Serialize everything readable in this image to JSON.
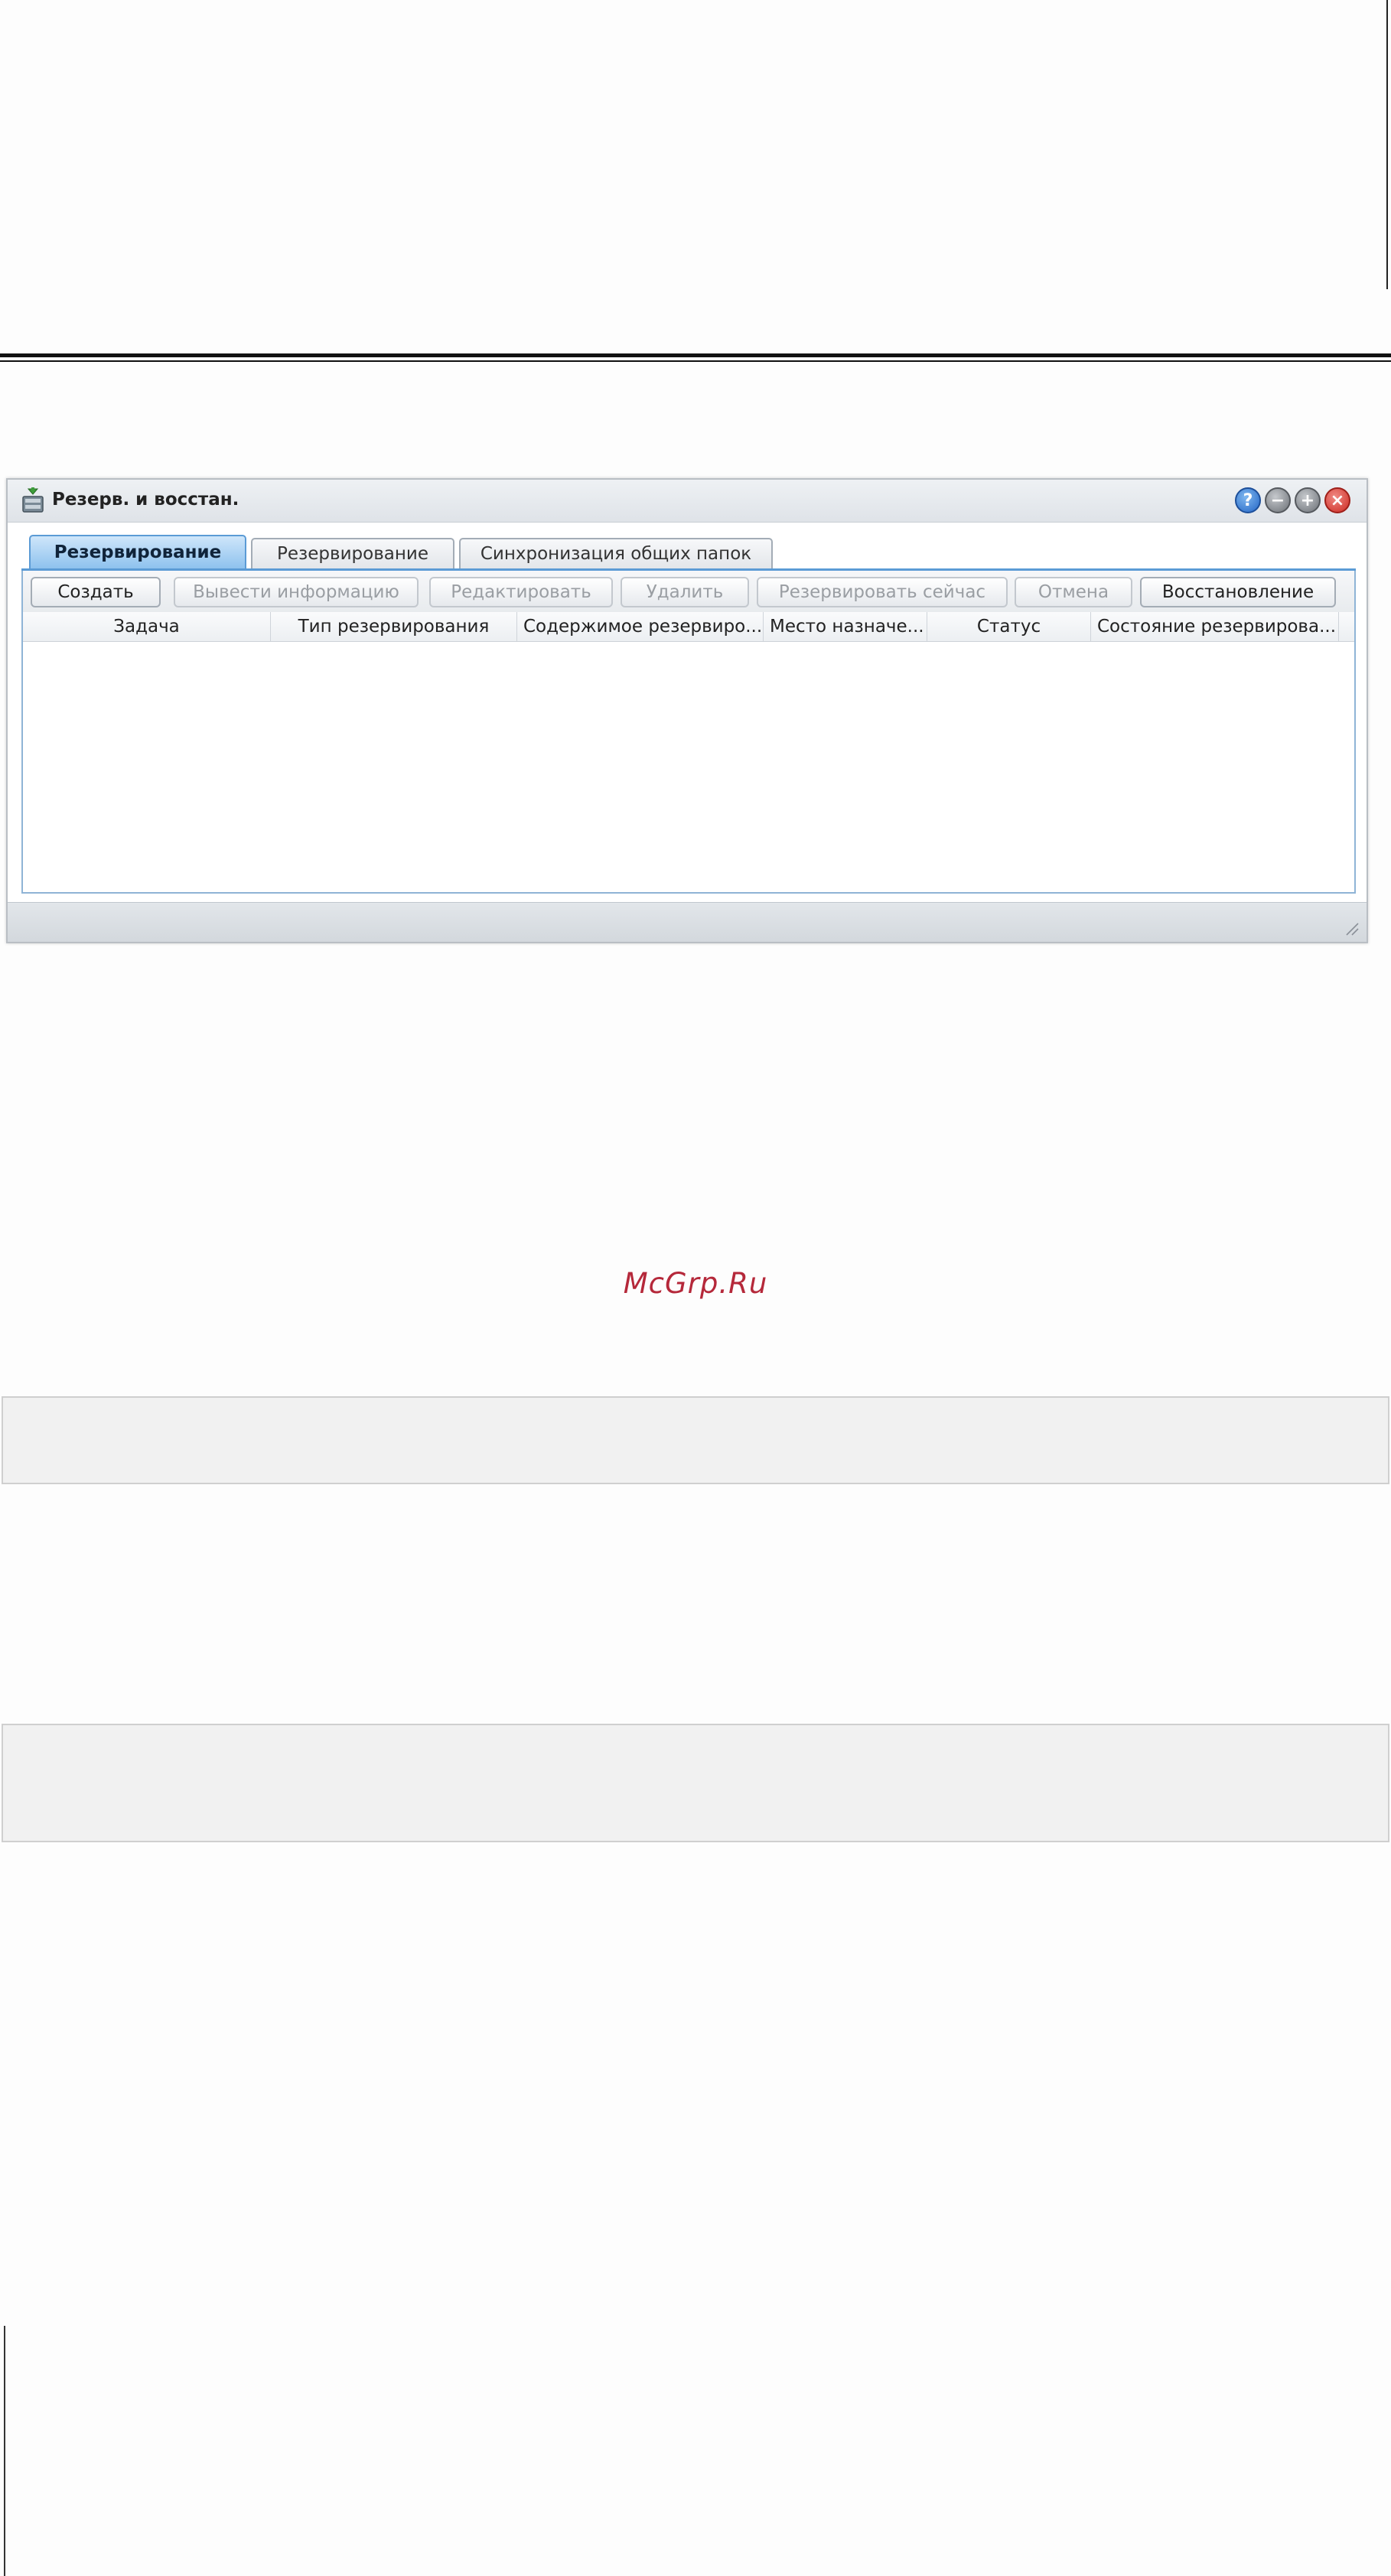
{
  "window": {
    "title": "Резерв. и восстан.",
    "icons": {
      "app": "backup-app-icon",
      "help": "help-icon",
      "minimize": "minimize-icon",
      "maximize": "maximize-icon",
      "close": "close-icon"
    }
  },
  "tabs": [
    {
      "label": "Резервирование",
      "active": true
    },
    {
      "label": "Резервирование",
      "active": false
    },
    {
      "label": "Синхронизация общих папок",
      "active": false
    }
  ],
  "toolbar": {
    "create": "Создать",
    "show_info": "Вывести информацию",
    "edit": "Редактировать",
    "delete": "Удалить",
    "backup_now": "Резервировать сейчас",
    "cancel": "Отмена",
    "restore": "Восстановление"
  },
  "table": {
    "columns": [
      "Задача",
      "Тип резервирования",
      "Содержимое резервиро...",
      "Место назначе...",
      "Статус",
      "Состояние резервирова..."
    ],
    "rows": []
  },
  "watermark": "McGrp.Ru",
  "colors": {
    "accent_tab": "#8ec2ee",
    "watermark": "#b5283a"
  }
}
